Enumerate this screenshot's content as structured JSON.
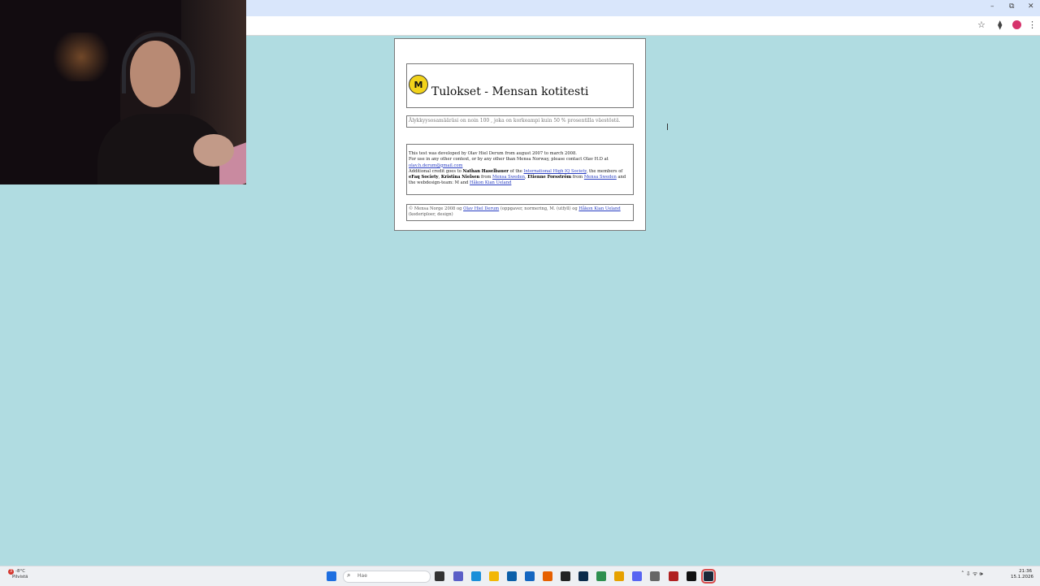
{
  "browser": {
    "window_controls": [
      "–",
      "⧉",
      "✕"
    ],
    "toolbar_icons": [
      "star-icon",
      "extensions-icon",
      "profile-icon",
      "menu-icon"
    ],
    "menu_glyph": "⋮",
    "star_glyph": "☆",
    "ext_glyph": "⧫"
  },
  "page": {
    "logo_text": "M",
    "title": "Tulokset - Mensan kotitesti",
    "result_text": "Älykkyysosamääräsi on noin 100 , joka on korkeampi kuin 50 % prosentilla väestöstä.",
    "credits": {
      "line1": "This test was developed by Olav Hiel Derum from august 2007 to march 2008.",
      "line2": "For use in any other context, or by any other than Mensa Norway, please contact Olav H.D at",
      "email": "olav.h.derum@gmail.com",
      "line3_pre": "Additional credit goes to",
      "nathan": "Nathan Haselbauer",
      "line3_mid": "of the",
      "iq_society": "International High IQ Society",
      "line3_post": ", the members of",
      "ifaq": "eFaq Society",
      "kristina": "Kristina Nielsen",
      "from": "from",
      "mensa_sweden_1": "Mensa Sweden",
      "etienne": "Etienne Forsström",
      "mensa_sweden_2": "Mensa Sweden",
      "and_web": "and the webdesign-team: M and",
      "hakon": "Håkon Kian Ueland"
    },
    "copyright": {
      "pre": "© Mensa Norge 2008 og",
      "olav_link": "Olav Hiel Derum",
      "mid": "(oppgaver, normering, M. (utfyll) og",
      "hakon_link": "Håkon Kian Ueland",
      "post": "(koderiploer, design)"
    }
  },
  "taskbar": {
    "weather_temp": "-8°C",
    "weather_label": "Pilvistä",
    "alert_count": "3",
    "search_placeholder": "Hae",
    "time": "21:36",
    "date": "15.1.2026",
    "tray_glyphs": "˄  ⇩  ᯤ  🕪",
    "apps": [
      {
        "name": "start-icon",
        "color": "#1e6fe0"
      },
      {
        "name": "file-icon",
        "color": "#333333"
      },
      {
        "name": "teams-icon",
        "color": "#5b5fc7"
      },
      {
        "name": "edge-icon",
        "color": "#1a8fd9"
      },
      {
        "name": "explorer-icon",
        "color": "#f2b705"
      },
      {
        "name": "store-icon",
        "color": "#0b5fa8"
      },
      {
        "name": "mail-icon",
        "color": "#1466c0"
      },
      {
        "name": "firefox-icon",
        "color": "#e66000"
      },
      {
        "name": "dropbox-icon",
        "color": "#222222"
      },
      {
        "name": "ps-icon",
        "color": "#0a2a4a"
      },
      {
        "name": "photos-icon",
        "color": "#2f8f4f"
      },
      {
        "name": "chrome-icon",
        "color": "#e6a100"
      },
      {
        "name": "discord-icon",
        "color": "#5865f2"
      },
      {
        "name": "settings-icon",
        "color": "#666666"
      },
      {
        "name": "obs-icon",
        "color": "#b02020"
      },
      {
        "name": "epic-icon",
        "color": "#111111"
      },
      {
        "name": "steam-icon",
        "color": "#1b2838"
      }
    ]
  }
}
